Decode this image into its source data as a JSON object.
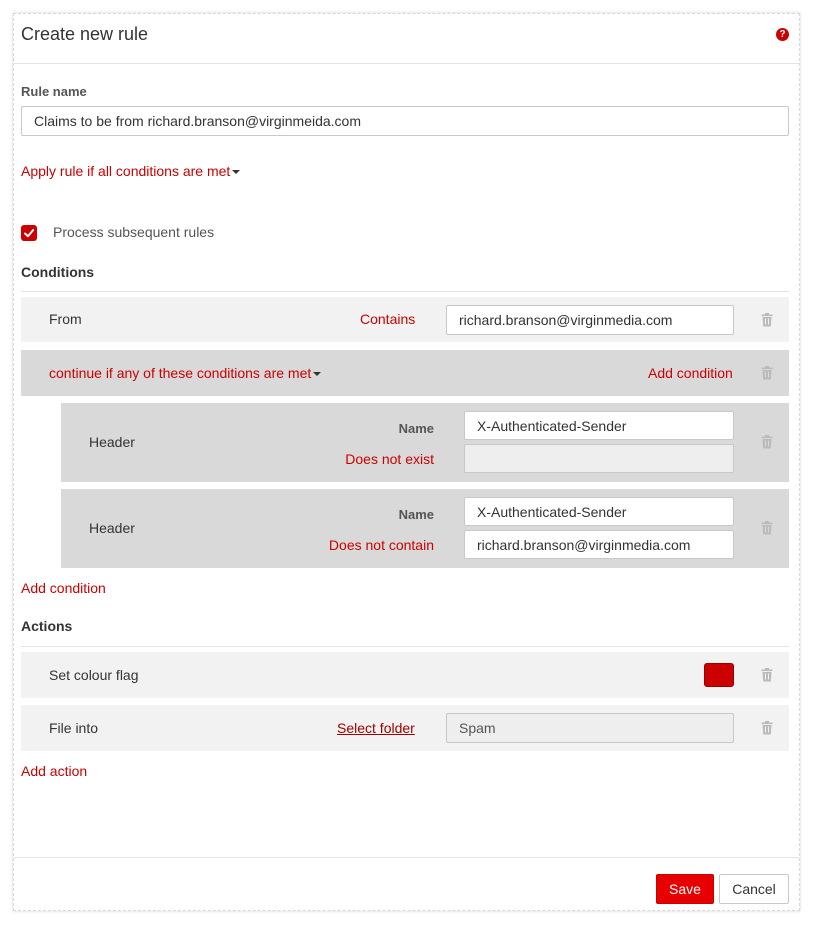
{
  "dialog": {
    "title": "Create new rule",
    "help_icon": "question-circle-icon"
  },
  "rule_name": {
    "label": "Rule name",
    "value": "Claims to be from richard.branson@virginmeida.com"
  },
  "apply_rule": {
    "label": "Apply rule if all conditions are met"
  },
  "process_subsequent": {
    "label": "Process subsequent rules",
    "checked": true
  },
  "conditions": {
    "title": "Conditions",
    "from": {
      "field": "From",
      "operator": "Contains",
      "value": "richard.branson@virginmedia.com"
    },
    "group": {
      "label": "continue if any of these conditions are met",
      "add_condition": "Add condition",
      "items": [
        {
          "field": "Header",
          "name_label": "Name",
          "name_value": "X-Authenticated-Sender",
          "operator": "Does not exist",
          "value": ""
        },
        {
          "field": "Header",
          "name_label": "Name",
          "name_value": "X-Authenticated-Sender",
          "operator": "Does not contain",
          "value": "richard.branson@virginmedia.com"
        }
      ]
    },
    "add_condition": "Add condition"
  },
  "actions": {
    "title": "Actions",
    "set_flag": {
      "label": "Set colour flag",
      "color": "#cc0000"
    },
    "file_into": {
      "label": "File into",
      "select_folder": "Select folder",
      "folder": "Spam"
    },
    "add_action": "Add action"
  },
  "footer": {
    "save": "Save",
    "cancel": "Cancel"
  },
  "colors": {
    "accent": "#cc0000",
    "save_button": "#e60000"
  },
  "icons": {
    "delete": "trash-icon",
    "checkbox": "checkmark-icon"
  }
}
